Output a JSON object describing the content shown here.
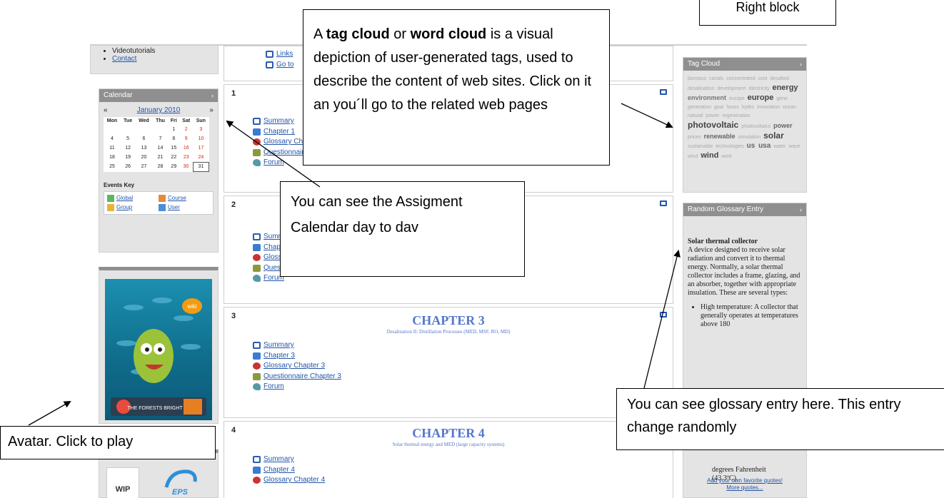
{
  "menu": {
    "items": [
      "Videotutorials",
      "Contact"
    ]
  },
  "calendar": {
    "title": "Calendar",
    "prev": "«",
    "next": "»",
    "month": "January 2010",
    "days": [
      "Mon",
      "Tue",
      "Wed",
      "Thu",
      "Fri",
      "Sat",
      "Sun"
    ],
    "weeks": [
      [
        "",
        "",
        "",
        "",
        "1",
        "2",
        "3"
      ],
      [
        "4",
        "5",
        "6",
        "7",
        "8",
        "9",
        "10"
      ],
      [
        "11",
        "12",
        "13",
        "14",
        "15",
        "16",
        "17"
      ],
      [
        "18",
        "19",
        "20",
        "21",
        "22",
        "23",
        "24"
      ],
      [
        "25",
        "26",
        "27",
        "28",
        "29",
        "30",
        "31"
      ]
    ],
    "events_key_label": "Events Key",
    "events_key": [
      {
        "label": "Global",
        "color": "#5cb85c"
      },
      {
        "label": "Course",
        "color": "#e58a3a"
      },
      {
        "label": "Group",
        "color": "#e5b53a"
      },
      {
        "label": "User",
        "color": "#4a8fd8"
      }
    ]
  },
  "avatar": {
    "badge": "wiki",
    "banner": "THE FORESTS BRIGHT"
  },
  "wip": {
    "logo_text": "WIP",
    "logo2_text": "EPS"
  },
  "top_links": [
    "Links",
    "Go to"
  ],
  "sections": [
    {
      "number": "1",
      "title": "",
      "subtitle": "",
      "links": [
        "Summary",
        "Chapter 1",
        "Glossary Chapter 1",
        "Questionnaire Chapter 1",
        "Forum"
      ]
    },
    {
      "number": "2",
      "title": "",
      "subtitle": "",
      "links": [
        "Summary",
        "Chapter 2",
        "Glossary Chapter 2",
        "Questionnaire Chapter 2",
        "Forum"
      ]
    },
    {
      "number": "3",
      "title": "CHAPTER 3",
      "subtitle": "Desalination II: Distillation Processes (MED, MSF, RO, MD)",
      "links": [
        "Summary",
        "Chapter 3",
        "Glossary Chapter 3",
        "Questionnaire Chapter 3",
        "Forum"
      ]
    },
    {
      "number": "4",
      "title": "CHAPTER 4",
      "subtitle": "Solar thermal energy and MED (large capacity systems)",
      "links": [
        "Summary",
        "Chapter 4",
        "Glossary Chapter 4"
      ]
    }
  ],
  "tag_cloud": {
    "title": "Tag Cloud",
    "line1": "biomass canals concentrated cost desalted desalination development electricity",
    "big1": "energy",
    "mid1": "environment",
    "small1": "europe",
    "big2": "europe",
    "line2": "gene generation goal hours hydro innovation ocean natural power regeneration",
    "big3": "photovoltaic",
    "line3": "photovoltaics",
    "mid3": "power",
    "small3": "prices",
    "mid4": "renewable",
    "small4": "simulation",
    "big4": "solar",
    "line4": "sustainable technologies",
    "mid5": "us usa",
    "small5": "water wave wind",
    "big5": "wind",
    "small6": "work"
  },
  "glossary": {
    "title": "Random Glossary Entry",
    "term": "Solar thermal collector",
    "definition": "A device designed to receive solar radiation and convert it to thermal energy. Normally, a solar thermal collector includes a frame, glazing, and an absorber, together with appropriate insulation. These are several types:",
    "bullet": "High temperature: A collector that generally operates at temperatures above 180",
    "tail1": "degrees Fahrenheit",
    "tail2": "(43.3ºC).",
    "footer1": "Add your own favorite quotes!",
    "footer2": "More quotes..."
  },
  "callouts": {
    "tag_cloud_a": "A ",
    "tag_cloud_b1": "tag cloud",
    "tag_cloud_or": " or ",
    "tag_cloud_b2": "word cloud",
    "tag_cloud_rest": " is a visual depiction of user-generated tags, used to describe the content of web sites. Click on it an you´ll go to the related web pages",
    "calendar": "You can see the Assigment Calendar day to dav",
    "glossary": "You can see glossary entry here. This entry change randomly",
    "avatar": "Avatar. Click to play",
    "right_block": "Right block"
  }
}
